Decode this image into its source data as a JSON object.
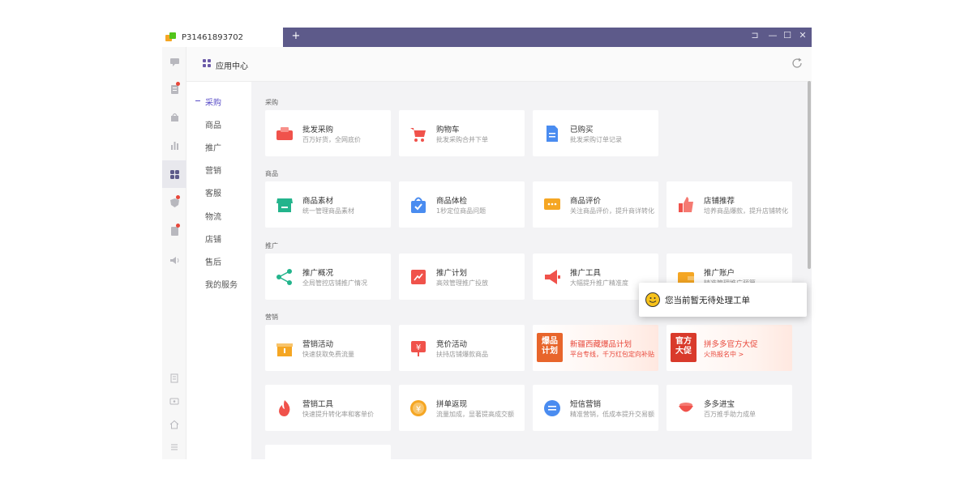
{
  "window": {
    "tab_title": "P31461893702",
    "tab_add": "+",
    "controls": {
      "pin": "⊐",
      "minimize": "—",
      "maximize": "☐",
      "close": "✕"
    }
  },
  "header": {
    "title": "应用中心"
  },
  "rail": {
    "items": [
      {
        "name": "message-icon",
        "badge": false
      },
      {
        "name": "order-icon",
        "badge": true
      },
      {
        "name": "bag-icon",
        "badge": false
      },
      {
        "name": "bar-chart-icon",
        "badge": false
      },
      {
        "name": "apps-icon",
        "badge": false,
        "active": true
      },
      {
        "name": "shield-icon",
        "badge": true
      },
      {
        "name": "book-icon",
        "badge": true
      },
      {
        "name": "speaker-icon",
        "badge": false
      }
    ],
    "bottom": [
      "receipt-icon",
      "ticket-icon",
      "home-icon",
      "menu-icon"
    ]
  },
  "categories": [
    "采购",
    "商品",
    "推广",
    "营销",
    "客服",
    "物流",
    "店铺",
    "售后",
    "我的服务"
  ],
  "active_category": "采购",
  "sections": [
    {
      "title": "采购",
      "cards": [
        {
          "title": "批发采购",
          "desc": "百万好货，全网底价",
          "icon": "wholesale-icon",
          "color": "#f0524b"
        },
        {
          "title": "购物车",
          "desc": "批发采购合并下单",
          "icon": "cart-icon",
          "color": "#f0524b"
        },
        {
          "title": "已购买",
          "desc": "批发采购订单记录",
          "icon": "document-icon",
          "color": "#4a8cf0"
        }
      ]
    },
    {
      "title": "商品",
      "cards": [
        {
          "title": "商品素材",
          "desc": "统一管理商品素材",
          "icon": "store-icon",
          "color": "#23b48c"
        },
        {
          "title": "商品体检",
          "desc": "1秒定位商品问题",
          "icon": "shopping-bag-check-icon",
          "color": "#4a8cf0"
        },
        {
          "title": "商品评价",
          "desc": "关注商品评价，提升商详转化",
          "icon": "comment-icon",
          "color": "#f5a623"
        },
        {
          "title": "店铺推荐",
          "desc": "培养商品爆款，提升店铺转化",
          "icon": "thumbs-up-icon",
          "color": "#f0524b"
        }
      ]
    },
    {
      "title": "推广",
      "cards": [
        {
          "title": "推广概况",
          "desc": "全局管控店铺推广情况",
          "icon": "share-icon",
          "color": "#23b48c"
        },
        {
          "title": "推广计划",
          "desc": "高效管理推广投放",
          "icon": "plan-chart-icon",
          "color": "#f0524b"
        },
        {
          "title": "推广工具",
          "desc": "大幅提升推广精准度",
          "icon": "megaphone-icon",
          "color": "#f0524b"
        },
        {
          "title": "推广账户",
          "desc": "精准管理推广预算",
          "icon": "wallet-icon",
          "color": "#f5a623"
        }
      ]
    },
    {
      "title": "营销",
      "cards": [
        {
          "title": "营销活动",
          "desc": "快速获取免费流量",
          "icon": "gift-icon",
          "color": "#f5a623"
        },
        {
          "title": "竞价活动",
          "desc": "扶持店铺爆款商品",
          "icon": "bid-tag-icon",
          "color": "#f0524b"
        },
        {
          "title": "新疆西藏爆品计划",
          "desc": "平台专线，千万红包定向补贴",
          "promo": true,
          "badge": [
            "爆品",
            "计划"
          ],
          "badge_color": "#e8652b"
        },
        {
          "title": "拼多多官方大促",
          "desc": "火热报名中 >",
          "promo": true,
          "badge": [
            "官方",
            "大促"
          ],
          "badge_color": "#d93a2b"
        },
        {
          "title": "营销工具",
          "desc": "快速提升转化率和客单价",
          "icon": "flame-icon",
          "color": "#f0524b"
        },
        {
          "title": "拼单返现",
          "desc": "流量加成，显著提高成交额",
          "icon": "coin-icon",
          "color": "#f5a623"
        },
        {
          "title": "短信营销",
          "desc": "精准营销，低成本提升交易额",
          "icon": "sms-icon",
          "color": "#4a8cf0"
        },
        {
          "title": "多多进宝",
          "desc": "百万推手助力成单",
          "icon": "treasure-bowl-icon",
          "color": "#f0524b"
        }
      ]
    }
  ],
  "toast": {
    "text": "您当前暂无待处理工单"
  }
}
